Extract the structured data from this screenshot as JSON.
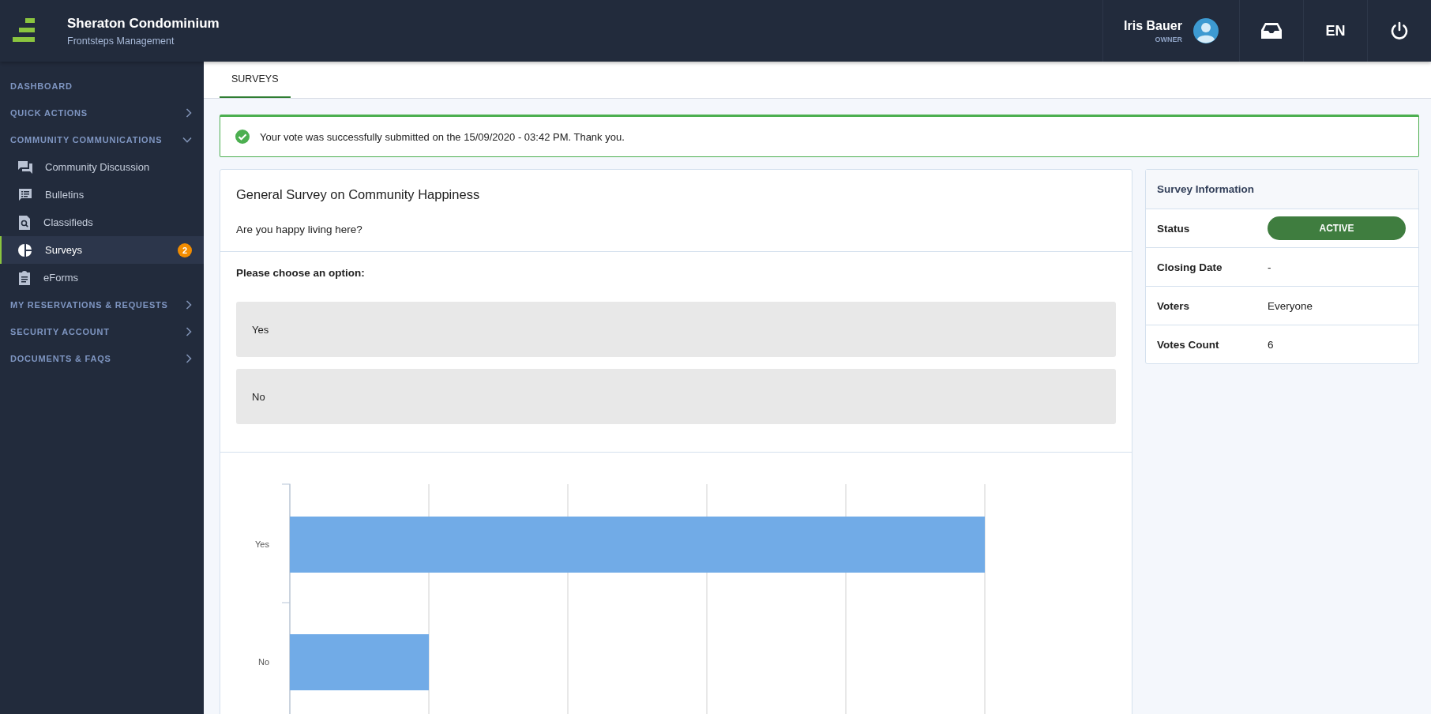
{
  "brand": {
    "title": "Sheraton Condominium",
    "subtitle": "Frontsteps Management"
  },
  "user": {
    "name": "Iris Bauer",
    "role": "OWNER"
  },
  "language": "EN",
  "sidebar": {
    "items": [
      {
        "kind": "section",
        "label": "DASHBOARD"
      },
      {
        "kind": "group",
        "label": "QUICK ACTIONS",
        "expanded": false
      },
      {
        "kind": "group",
        "label": "COMMUNITY COMMUNICATIONS",
        "expanded": true
      },
      {
        "kind": "link",
        "label": "Community Discussion",
        "selected": false
      },
      {
        "kind": "link",
        "label": "Bulletins",
        "selected": false
      },
      {
        "kind": "link",
        "label": "Classifieds",
        "selected": false
      },
      {
        "kind": "link",
        "label": "Surveys",
        "selected": true,
        "badge": "2"
      },
      {
        "kind": "link",
        "label": "eForms",
        "selected": false
      },
      {
        "kind": "group",
        "label": "MY RESERVATIONS & REQUESTS",
        "expanded": false
      },
      {
        "kind": "group",
        "label": "SECURITY ACCOUNT",
        "expanded": false
      },
      {
        "kind": "group",
        "label": "DOCUMENTS & FAQS",
        "expanded": false
      }
    ]
  },
  "tabs": [
    {
      "label": "SURVEYS",
      "selected": true
    }
  ],
  "alert": {
    "kind": "success",
    "text": "Your vote was successfully submitted on the 15/09/2020 - 03:42 PM. Thank you."
  },
  "survey": {
    "title": "General Survey on Community Happiness",
    "question": "Are you happy living here?",
    "prompt": "Please choose an option:",
    "options": [
      {
        "label": "Yes"
      },
      {
        "label": "No"
      }
    ],
    "chart_labels": [
      "Yes",
      "No"
    ]
  },
  "info": {
    "title": "Survey Information",
    "rows": [
      {
        "kind": "status",
        "label": "Status",
        "value": "ACTIVE"
      },
      {
        "kind": "text",
        "label": "Closing Date",
        "value": "-"
      },
      {
        "kind": "text",
        "label": "Voters",
        "value": "Everyone"
      },
      {
        "kind": "text",
        "label": "Votes Count",
        "value": "6"
      }
    ]
  }
}
